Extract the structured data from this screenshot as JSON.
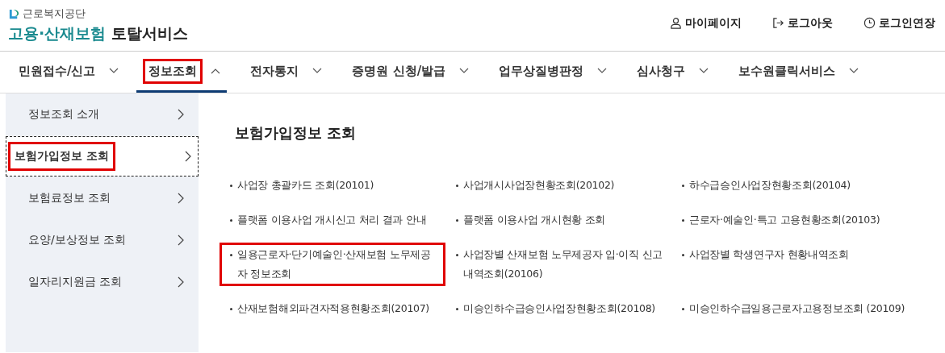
{
  "header": {
    "org_name": "근로복지공단",
    "service_name_accent": "고용·산재보험",
    "service_name": "토탈서비스",
    "links": [
      {
        "kind": "user",
        "label": "마이페이지"
      },
      {
        "kind": "logout",
        "label": "로그아웃"
      },
      {
        "kind": "clock",
        "label": "로그인연장"
      }
    ]
  },
  "nav": [
    {
      "label": "민원접수/신고",
      "selected": false,
      "highlighted": false
    },
    {
      "label": "정보조회",
      "selected": true,
      "highlighted": true
    },
    {
      "label": "전자통지",
      "selected": false,
      "highlighted": false
    },
    {
      "label": "증명원 신청/발급",
      "selected": false,
      "highlighted": false
    },
    {
      "label": "업무상질병판정",
      "selected": false,
      "highlighted": false
    },
    {
      "label": "심사청구",
      "selected": false,
      "highlighted": false
    },
    {
      "label": "보수원클릭서비스",
      "selected": false,
      "highlighted": false
    }
  ],
  "sidebar": {
    "items": [
      {
        "label": "정보조회 소개",
        "selected": false,
        "highlighted": false
      },
      {
        "label": "보험가입정보 조회",
        "selected": true,
        "highlighted": true
      },
      {
        "label": "보험료정보 조회",
        "selected": false,
        "highlighted": false
      },
      {
        "label": "요양/보상정보 조회",
        "selected": false,
        "highlighted": false
      },
      {
        "label": "일자리지원금 조회",
        "selected": false,
        "highlighted": false
      }
    ]
  },
  "content": {
    "title": "보험가입정보 조회",
    "links": [
      {
        "label": "사업장 총괄카드 조회(20101)",
        "highlighted": false
      },
      {
        "label": "사업개시사업장현황조회(20102)",
        "highlighted": false
      },
      {
        "label": "하수급승인사업장현황조회(20104)",
        "highlighted": false
      },
      {
        "label": "플랫폼 이용사업 개시신고 처리 결과 안내",
        "highlighted": false
      },
      {
        "label": "플랫폼 이용사업 개시현황 조회",
        "highlighted": false
      },
      {
        "label": "근로자·예술인·특고 고용현황조회(20103)",
        "highlighted": false
      },
      {
        "label": "일용근로자·단기예술인·산재보험 노무제공자 정보조회",
        "highlighted": true
      },
      {
        "label": "사업장별 산재보험 노무제공자 입·이직 신고 내역조회(20106)",
        "highlighted": false
      },
      {
        "label": "사업장별 학생연구자 현황내역조회",
        "highlighted": false
      },
      {
        "label": "산재보험해외파견자적용현황조회(20107)",
        "highlighted": false
      },
      {
        "label": "미승인하수급승인사업장현황조회(20108)",
        "highlighted": false
      },
      {
        "label": "미승인하수급일용근로자고용정보조회 (20109)",
        "highlighted": false
      }
    ]
  }
}
